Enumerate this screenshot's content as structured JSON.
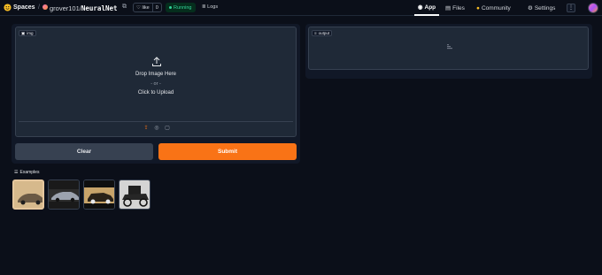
{
  "header": {
    "brand": "Spaces",
    "owner": "grover101",
    "slash": "/",
    "repo": "NeuralNet",
    "like_label": "like",
    "like_count": "0",
    "status": "Running",
    "logs": "Logs",
    "nav": [
      {
        "label": "App",
        "icon": "app-icon"
      },
      {
        "label": "Files",
        "icon": "files-icon"
      },
      {
        "label": "Community",
        "icon": "community-icon"
      },
      {
        "label": "Settings",
        "icon": "gear-icon"
      }
    ],
    "menu": "⋮"
  },
  "input": {
    "label": "img",
    "drop_text": "Drop Image Here",
    "or_text": "- or -",
    "click_text": "Click to Upload",
    "sources": [
      "upload-icon",
      "webcam-icon",
      "clipboard-icon"
    ]
  },
  "buttons": {
    "clear": "Clear",
    "submit": "Submit"
  },
  "output": {
    "label": "output"
  },
  "examples": {
    "label": "Examples",
    "items": [
      "example-car-1",
      "example-car-2",
      "example-car-3",
      "example-car-4"
    ],
    "selected_index": 0
  },
  "colors": {
    "background": "#0b0f19",
    "panel": "#111827",
    "box": "#1f2937",
    "accent": "#f97316",
    "status": "#34d399"
  }
}
